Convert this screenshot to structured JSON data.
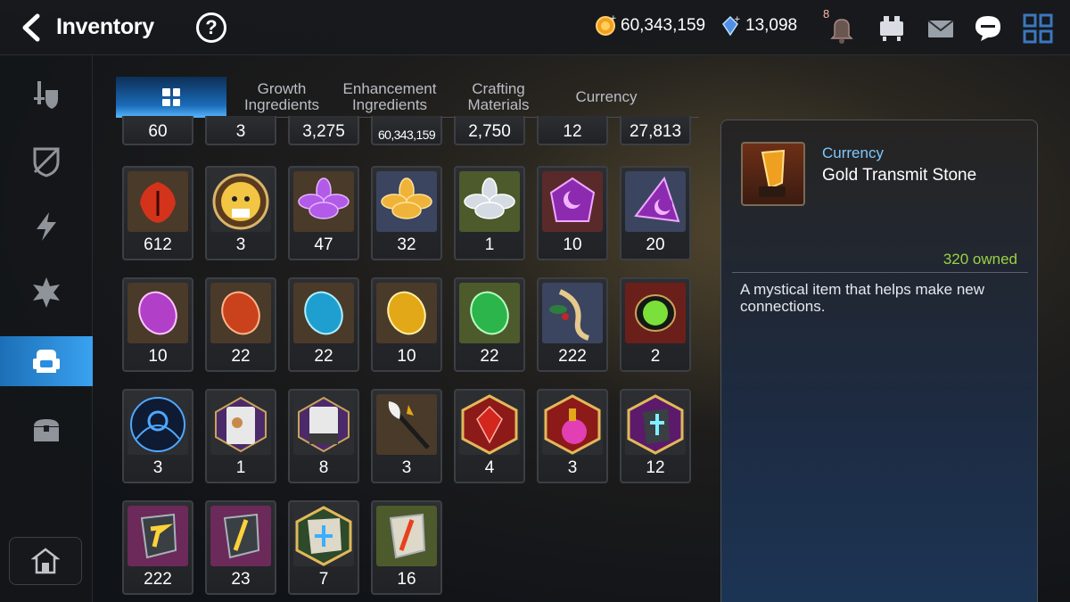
{
  "header": {
    "title": "Inventory",
    "help_label": "?",
    "gold": "60,343,159",
    "crystals": "13,098",
    "notification_badge": "8"
  },
  "sidebar": {
    "items": [
      {
        "icon": "sword-shield-icon",
        "active": false
      },
      {
        "icon": "broken-shield-icon",
        "active": false
      },
      {
        "icon": "lightning-icon",
        "active": false
      },
      {
        "icon": "spiky-emblem-icon",
        "active": false
      },
      {
        "icon": "backpack-icon",
        "active": true
      },
      {
        "icon": "treasure-chest-icon",
        "active": false
      }
    ],
    "bottom_icon": "home-icon"
  },
  "tabs": [
    {
      "label": "",
      "icon": "grid-icon",
      "active": true
    },
    {
      "label": "Growth\nIngredients",
      "active": false
    },
    {
      "label": "Enhancement\nIngredients",
      "active": false
    },
    {
      "label": "Crafting\nMaterials",
      "active": false
    },
    {
      "label": "Currency",
      "active": false
    }
  ],
  "items": {
    "row0": [
      "60",
      "3",
      "3,275",
      "60,343,159",
      "2,750",
      "12",
      "27,813"
    ],
    "row1": [
      {
        "count": "612",
        "icon": "red-leaf-emblem-icon"
      },
      {
        "count": "3",
        "icon": "chick-portrait-icon"
      },
      {
        "count": "47",
        "icon": "purple-lotus-icon"
      },
      {
        "count": "32",
        "icon": "gold-lotus-icon"
      },
      {
        "count": "1",
        "icon": "silver-lotus-icon"
      },
      {
        "count": "10",
        "icon": "purple-moon-gem-icon"
      },
      {
        "count": "20",
        "icon": "purple-moon-shard-icon"
      }
    ],
    "row2": [
      {
        "count": "10",
        "icon": "purple-rune-stone-icon"
      },
      {
        "count": "22",
        "icon": "red-rune-stone-icon"
      },
      {
        "count": "22",
        "icon": "blue-rune-stone-icon"
      },
      {
        "count": "10",
        "icon": "yellow-rune-stone-icon"
      },
      {
        "count": "22",
        "icon": "green-rune-stone-icon"
      },
      {
        "count": "222",
        "icon": "root-herb-icon"
      },
      {
        "count": "2",
        "icon": "green-orb-icon"
      }
    ],
    "row3": [
      {
        "count": "3",
        "icon": "blue-magic-circle-icon"
      },
      {
        "count": "1",
        "icon": "pet-food-bag-icon"
      },
      {
        "count": "8",
        "icon": "pet-food-bag-icon"
      },
      {
        "count": "3",
        "icon": "feather-staff-icon"
      },
      {
        "count": "4",
        "icon": "red-crystal-hexagon-icon"
      },
      {
        "count": "3",
        "icon": "pink-potion-icon"
      },
      {
        "count": "12",
        "icon": "cross-stone-hexagon-icon"
      }
    ],
    "row4": [
      {
        "count": "222",
        "icon": "yellow-rune-shard-icon"
      },
      {
        "count": "23",
        "icon": "yellow-slash-shard-icon"
      },
      {
        "count": "7",
        "icon": "blue-star-stone-icon"
      },
      {
        "count": "16",
        "icon": "red-slash-stone-icon"
      }
    ]
  },
  "detail": {
    "category": "Currency",
    "name": "Gold Transmit Stone",
    "owned": "320 owned",
    "description": "A mystical item that helps make new connections."
  },
  "colors": {
    "accent_blue": "#3aa2f0",
    "owned_green": "#9ad145",
    "category_blue": "#7ec8ff"
  }
}
